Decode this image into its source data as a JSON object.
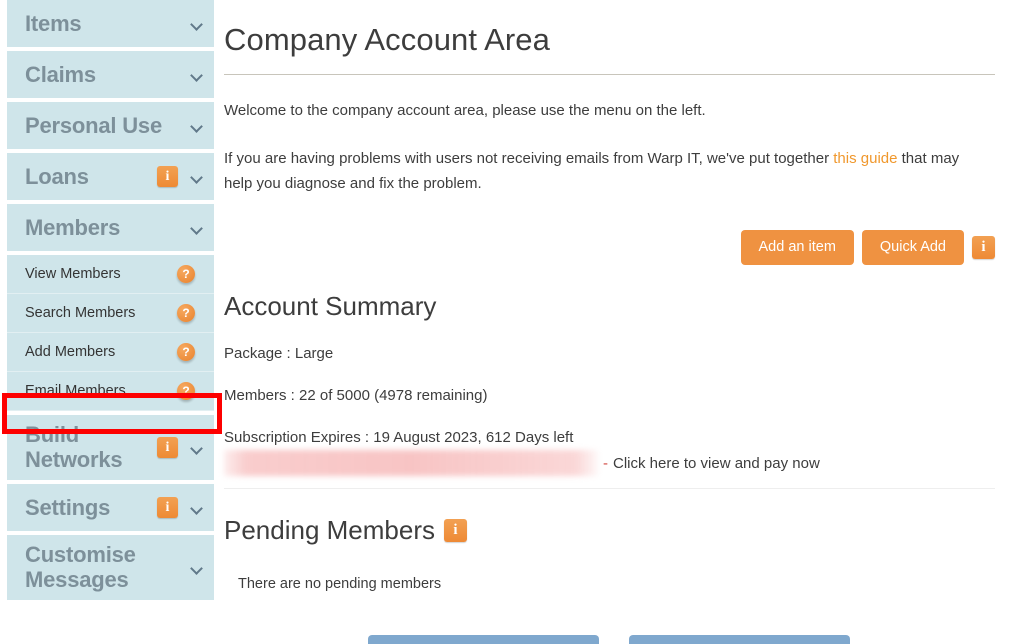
{
  "sidebar": {
    "groups": [
      {
        "label": "Items",
        "has_info": false,
        "has_chevron": true,
        "two_line": false
      },
      {
        "label": "Claims",
        "has_info": false,
        "has_chevron": true,
        "two_line": false
      },
      {
        "label": "Personal Use",
        "has_info": false,
        "has_chevron": true,
        "two_line": false
      },
      {
        "label": "Loans",
        "has_info": true,
        "has_chevron": true,
        "two_line": false
      },
      {
        "label": "Members",
        "has_info": false,
        "has_chevron": true,
        "two_line": false
      }
    ],
    "sub_items": [
      {
        "label": "View Members",
        "help": "?"
      },
      {
        "label": "Search Members",
        "help": "?"
      },
      {
        "label": "Add Members",
        "help": "?"
      },
      {
        "label": "Email Members",
        "help": "?",
        "highlighted": true
      }
    ],
    "groups_lower": [
      {
        "label": "Build Networks",
        "has_info": true,
        "has_chevron": true,
        "two_line": true
      },
      {
        "label": "Settings",
        "has_info": true,
        "has_chevron": true,
        "two_line": false
      },
      {
        "label": "Customise Messages",
        "has_info": false,
        "has_chevron": true,
        "two_line": true
      }
    ],
    "info_glyph": "i",
    "help_glyph": "?"
  },
  "main": {
    "page_title": "Company Account Area",
    "welcome_text": "Welcome to the company account area, please use the menu on the left.",
    "email_help_prefix": "If you are having problems with users not receiving emails from Warp IT, we've put together ",
    "email_help_link": "this guide",
    "email_help_suffix": " that may help you diagnose and fix the problem.",
    "add_item_label": "Add an item",
    "quick_add_label": "Quick Add",
    "toolbar_info_glyph": "i",
    "account_summary": {
      "heading": "Account Summary",
      "package_line": "Package : Large",
      "members_line": "Members : 22 of 5000 (4978 remaining)",
      "subscription_line": "Subscription Expires : 19 August 2023, 612 Days left",
      "pay_dash": "-",
      "pay_link_text": "Click here to view and pay now"
    },
    "pending_members": {
      "heading": "Pending Members",
      "info_glyph": "i",
      "empty_text": "There are no pending members"
    },
    "bottom_buttons": [
      {
        "label": ""
      },
      {
        "label": ""
      }
    ]
  },
  "colors": {
    "sidebar_bg": "#cfe5ea",
    "accent_orange": "#ef9241",
    "link_orange": "#f0982d",
    "highlight_red": "#fd0000",
    "blue_button": "#7fa8ce"
  }
}
